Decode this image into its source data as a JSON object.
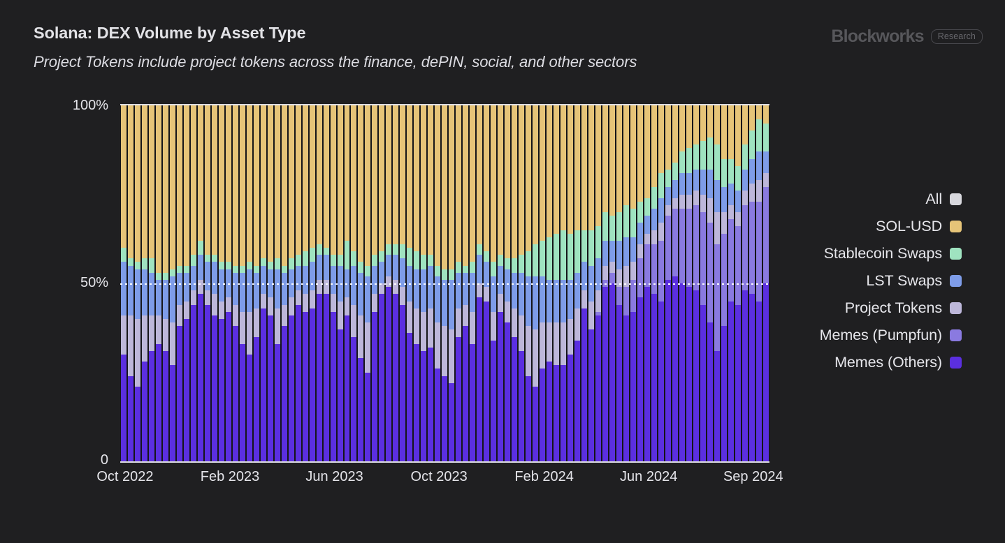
{
  "header": {
    "title": "Solana: DEX Volume by Asset Type",
    "subtitle": "Project Tokens include project tokens across the finance, dePIN, social, and other sectors",
    "brand_name": "Blockworks",
    "brand_badge": "Research"
  },
  "legend": {
    "items": [
      {
        "label": "All",
        "color": "#d8d8de"
      },
      {
        "label": "SOL-USD",
        "color": "#e6c478"
      },
      {
        "label": "Stablecoin Swaps",
        "color": "#9fe3c0"
      },
      {
        "label": "LST Swaps",
        "color": "#7e9ce8"
      },
      {
        "label": "Project Tokens",
        "color": "#bdb7da"
      },
      {
        "label": "Memes (Pumpfun)",
        "color": "#8a7ae0"
      },
      {
        "label": "Memes (Others)",
        "color": "#5b2fe0"
      }
    ]
  },
  "chart_data": {
    "type": "bar",
    "stacked": true,
    "normalized": true,
    "title": "Solana: DEX Volume by Asset Type",
    "subtitle": "Project Tokens include project tokens across the finance, dePIN, social, and other sectors",
    "xlabel": "",
    "ylabel": "",
    "ylim": [
      0,
      100
    ],
    "ytick_labels": [
      "0",
      "50%",
      "100%"
    ],
    "ytick_values": [
      0,
      50,
      100
    ],
    "grid": "horizontal-dotted-at-50",
    "legend_position": "right",
    "xtick_labels": [
      "Oct 2022",
      "Feb 2023",
      "Jun 2023",
      "Oct 2023",
      "Feb 2024",
      "Jun 2024",
      "Sep 2024"
    ],
    "xtick_positions_pct": [
      0.75,
      16.9,
      33.0,
      49.1,
      65.3,
      81.4,
      97.5
    ],
    "series_order": [
      "Memes (Others)",
      "Memes (Pumpfun)",
      "Project Tokens",
      "LST Swaps",
      "Stablecoin Swaps",
      "SOL-USD"
    ],
    "series": [
      {
        "name": "Memes (Others)",
        "color": "#5b2fe0",
        "values": [
          30,
          24,
          21,
          28,
          31,
          33,
          31,
          27,
          38,
          40,
          44,
          47,
          44,
          41,
          40,
          42,
          38,
          33,
          30,
          35,
          43,
          41,
          33,
          38,
          41,
          44,
          42,
          43,
          47,
          47,
          42,
          37,
          41,
          35,
          29,
          25,
          42,
          47,
          49,
          47,
          44,
          36,
          33,
          31,
          32,
          26,
          24,
          22,
          35,
          38,
          33,
          46,
          45,
          34,
          42,
          39,
          35,
          31,
          24,
          21,
          26,
          28,
          27,
          27,
          30,
          34,
          43,
          37,
          41,
          49,
          50,
          44,
          41,
          42,
          46,
          49,
          47,
          45,
          51,
          52,
          50,
          49,
          48,
          44,
          39,
          31,
          38,
          45,
          44,
          48,
          47,
          45,
          50
        ]
      },
      {
        "name": "Memes (Pumpfun)",
        "color": "#8a7ae0",
        "values": [
          0,
          0,
          0,
          0,
          0,
          0,
          0,
          0,
          0,
          0,
          0,
          0,
          0,
          0,
          0,
          0,
          0,
          0,
          0,
          0,
          0,
          0,
          0,
          0,
          0,
          0,
          0,
          0,
          0,
          0,
          0,
          0,
          0,
          0,
          0,
          0,
          0,
          0,
          0,
          0,
          0,
          0,
          0,
          0,
          0,
          0,
          0,
          0,
          0,
          0,
          0,
          0,
          0,
          0,
          0,
          0,
          0,
          0,
          0,
          0,
          0,
          0,
          0,
          0,
          0,
          0,
          0,
          0,
          1,
          2,
          3,
          5,
          8,
          9,
          11,
          12,
          14,
          17,
          18,
          19,
          21,
          22,
          24,
          26,
          28,
          30,
          26,
          23,
          22,
          24,
          26,
          28,
          27
        ]
      },
      {
        "name": "Project Tokens",
        "color": "#bdb7da",
        "values": [
          11,
          17,
          19,
          13,
          10,
          8,
          9,
          12,
          6,
          5,
          4,
          4,
          4,
          6,
          5,
          4,
          6,
          9,
          12,
          8,
          4,
          5,
          10,
          6,
          5,
          4,
          5,
          5,
          4,
          4,
          5,
          8,
          5,
          9,
          12,
          14,
          5,
          3,
          3,
          4,
          5,
          9,
          10,
          11,
          11,
          13,
          14,
          15,
          8,
          6,
          9,
          4,
          4,
          8,
          5,
          6,
          8,
          10,
          14,
          16,
          13,
          11,
          12,
          12,
          10,
          9,
          5,
          8,
          6,
          4,
          3,
          5,
          6,
          5,
          4,
          3,
          4,
          5,
          3,
          3,
          4,
          4,
          4,
          5,
          7,
          9,
          6,
          4,
          4,
          4,
          5,
          6,
          4
        ]
      },
      {
        "name": "LST Swaps",
        "color": "#7e9ce8",
        "values": [
          15,
          14,
          14,
          13,
          12,
          10,
          11,
          13,
          9,
          8,
          7,
          7,
          8,
          9,
          9,
          8,
          9,
          11,
          12,
          10,
          8,
          8,
          11,
          9,
          8,
          7,
          8,
          8,
          7,
          7,
          8,
          10,
          8,
          11,
          12,
          13,
          8,
          6,
          6,
          7,
          8,
          10,
          11,
          12,
          12,
          13,
          13,
          14,
          10,
          9,
          11,
          8,
          7,
          10,
          8,
          9,
          10,
          12,
          14,
          15,
          13,
          12,
          12,
          12,
          11,
          10,
          8,
          10,
          9,
          7,
          6,
          8,
          8,
          7,
          6,
          5,
          6,
          7,
          5,
          5,
          6,
          6,
          6,
          7,
          8,
          9,
          7,
          6,
          6,
          6,
          7,
          8,
          6
        ]
      },
      {
        "name": "Stablecoin Swaps",
        "color": "#9fe3c0",
        "values": [
          4,
          2,
          2,
          3,
          4,
          2,
          2,
          2,
          2,
          2,
          3,
          4,
          2,
          2,
          2,
          2,
          2,
          2,
          2,
          2,
          2,
          2,
          3,
          2,
          3,
          3,
          4,
          4,
          3,
          2,
          3,
          3,
          8,
          4,
          3,
          3,
          3,
          3,
          3,
          3,
          4,
          5,
          5,
          4,
          3,
          3,
          3,
          3,
          3,
          2,
          3,
          3,
          3,
          4,
          3,
          3,
          4,
          5,
          7,
          9,
          10,
          12,
          13,
          14,
          13,
          12,
          9,
          10,
          9,
          8,
          7,
          8,
          9,
          8,
          6,
          5,
          6,
          7,
          5,
          5,
          6,
          7,
          7,
          8,
          9,
          10,
          8,
          7,
          7,
          7,
          8,
          9,
          8
        ]
      },
      {
        "name": "SOL-USD",
        "color": "#e6c478",
        "values": [
          40,
          43,
          44,
          43,
          43,
          47,
          47,
          46,
          45,
          45,
          42,
          38,
          42,
          42,
          44,
          44,
          45,
          45,
          44,
          45,
          43,
          44,
          43,
          45,
          43,
          42,
          41,
          40,
          39,
          40,
          42,
          42,
          38,
          41,
          44,
          45,
          42,
          41,
          39,
          39,
          39,
          40,
          41,
          42,
          42,
          45,
          46,
          46,
          44,
          45,
          44,
          39,
          41,
          44,
          42,
          43,
          43,
          42,
          41,
          39,
          38,
          37,
          36,
          35,
          36,
          35,
          35,
          35,
          34,
          30,
          31,
          30,
          28,
          29,
          27,
          26,
          23,
          19,
          18,
          16,
          13,
          12,
          11,
          10,
          9,
          11,
          15,
          15,
          17,
          11,
          7,
          4,
          5
        ]
      }
    ]
  }
}
